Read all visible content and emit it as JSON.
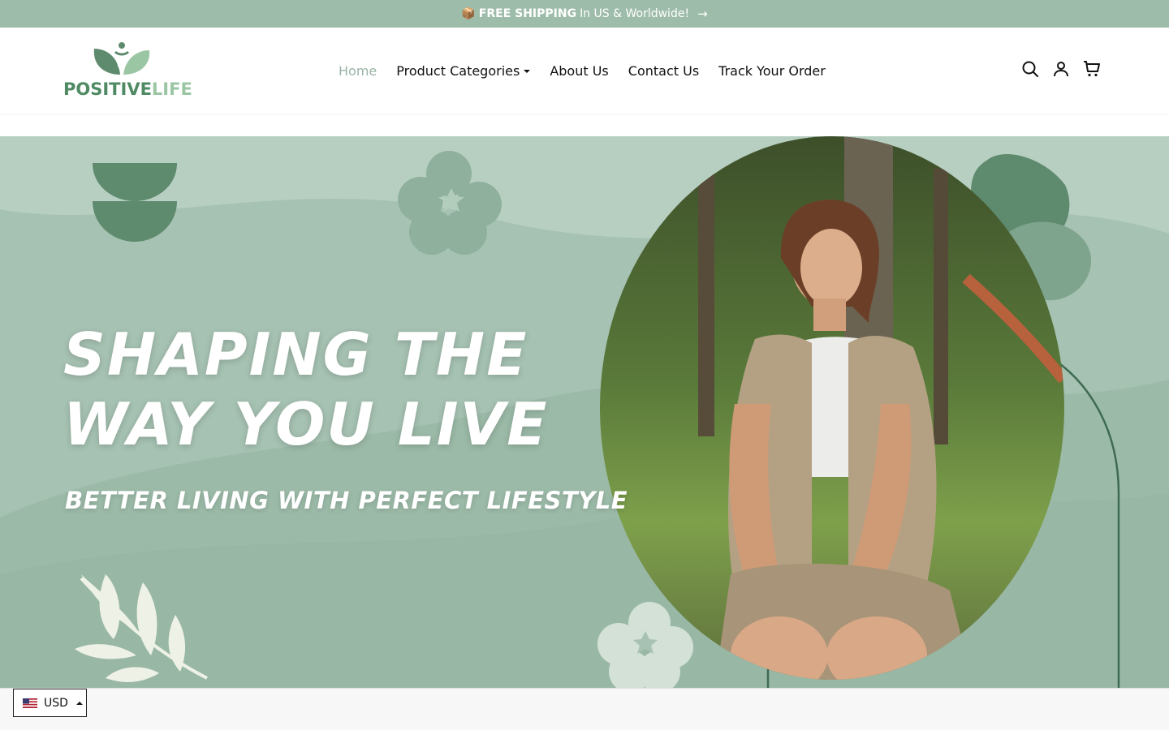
{
  "announcement": {
    "emoji": "📦",
    "bold_text": "FREE SHIPPING",
    "text": "In US & Worldwide!",
    "arrow": "→"
  },
  "logo": {
    "word_part1": "POSITIVE",
    "word_part2": "LIFE",
    "colors": {
      "primary": "#4f8a63",
      "secondary": "#9bc6a4"
    }
  },
  "nav": {
    "items": [
      {
        "label": "Home",
        "active": true
      },
      {
        "label": "Product Categories",
        "has_dropdown": true
      },
      {
        "label": "About Us"
      },
      {
        "label": "Contact Us"
      },
      {
        "label": "Track Your Order"
      }
    ]
  },
  "header_icons": [
    "search-icon",
    "account-icon",
    "cart-icon"
  ],
  "hero": {
    "headline_line1": "SHAPING THE",
    "headline_line2": "WAY YOU LIVE",
    "subheadline": "BETTER LIVING WITH PERFECT LIFESTYLE"
  },
  "currency": {
    "flag": "us-flag-icon",
    "code": "USD"
  },
  "colors": {
    "announcement_bg": "#9ebcaa",
    "hero_bg": "#a6c2b2",
    "dark_green": "#5e8a6e",
    "nav_active": "#9ab4a6"
  }
}
